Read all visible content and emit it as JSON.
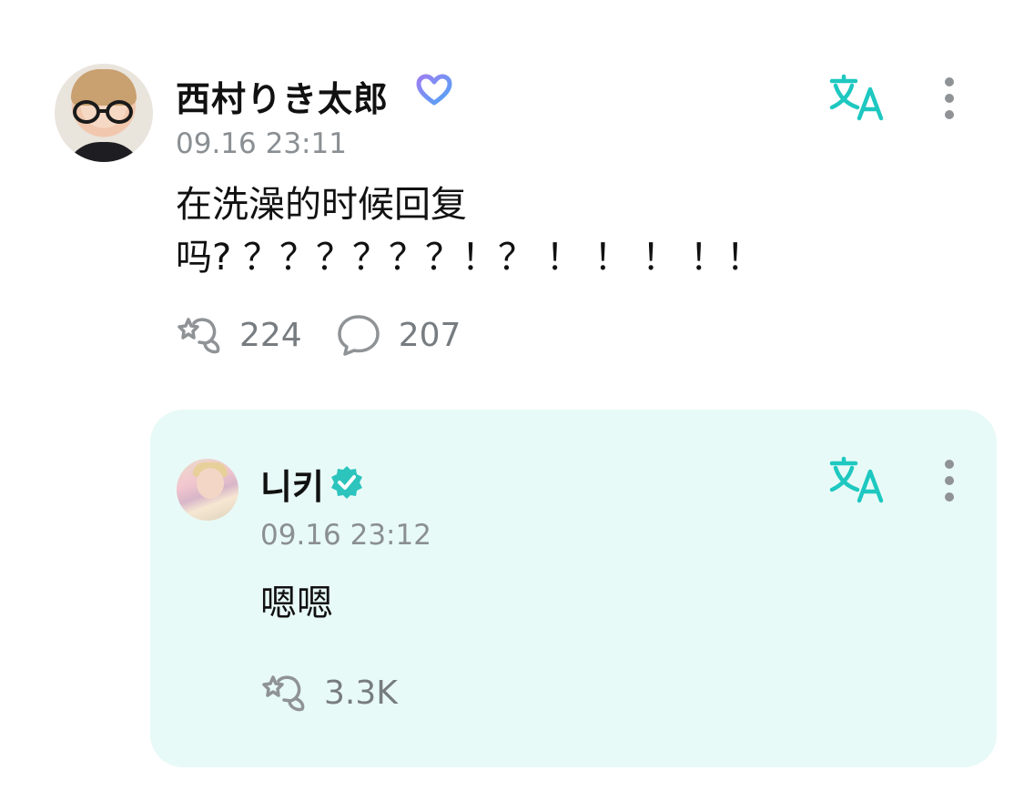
{
  "post": {
    "author": "西村りき太郎",
    "timestamp": "09.16 23:11",
    "text": "在洗澡的时候回复\n吗? ？？？？？？！？ ！ ！ ！ ！！",
    "reactions": "224",
    "comments": "207",
    "icons": {
      "badge": "heart-badge-icon",
      "translate": "translate-icon",
      "more": "more-vertical-icon",
      "reaction": "reaction-icon",
      "comment": "comment-bubble-icon"
    }
  },
  "reply": {
    "author": "니키",
    "timestamp": "09.16 23:12",
    "text": "嗯嗯",
    "reactions": "3.3K",
    "icons": {
      "badge": "verified-badge-icon",
      "translate": "translate-icon",
      "more": "more-vertical-icon",
      "reaction": "reaction-icon"
    }
  },
  "colors": {
    "accent": "#1ec8c0",
    "reply_background": "#e8faf7",
    "secondary_text": "#8a8f93",
    "heart_badge": "#7a8cf2"
  }
}
